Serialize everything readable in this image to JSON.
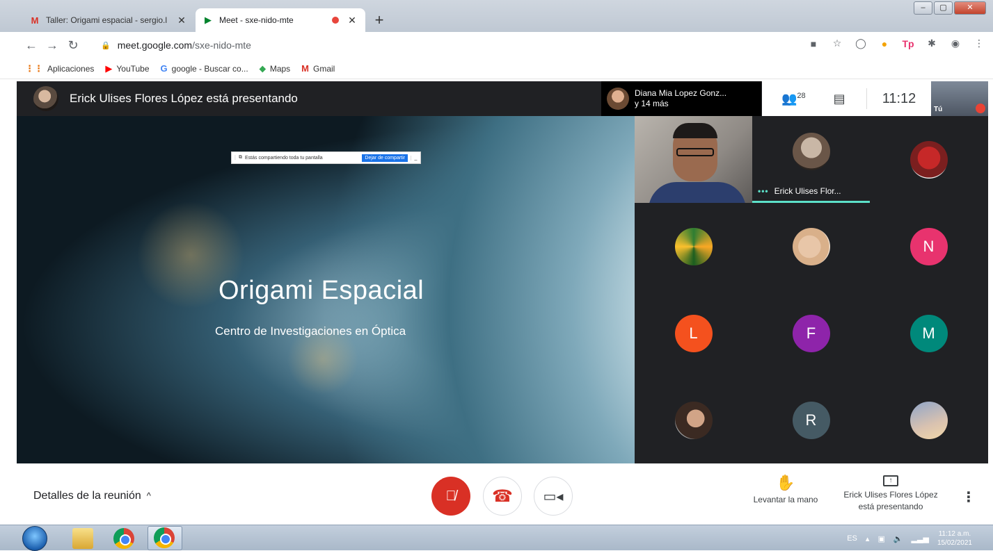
{
  "browser": {
    "tabs": [
      {
        "title": "Taller: Origami espacial - sergio.l",
        "favicon": "gmail-icon",
        "active": false
      },
      {
        "title": "Meet - sxe-nido-mte",
        "favicon": "meet-icon",
        "active": true
      }
    ],
    "new_tab": "+",
    "url_host": "meet.google.com",
    "url_path": "/sxe-nido-mte",
    "bookmarks": [
      {
        "label": "Aplicaciones",
        "icon": "apps-icon"
      },
      {
        "label": "YouTube",
        "icon": "youtube-icon"
      },
      {
        "label": "google - Buscar co...",
        "icon": "google-icon"
      },
      {
        "label": "Maps",
        "icon": "maps-icon"
      },
      {
        "label": "Gmail",
        "icon": "gmail-icon"
      }
    ]
  },
  "meet": {
    "presenter_banner": "Erick Ulises Flores López está presentando",
    "pinned_name": "Diana Mia Lopez Gonz...",
    "pinned_more": "y 14 más",
    "participant_count": "28",
    "time": "11:12",
    "self_label": "Tú",
    "share_bar": {
      "text": "Estás compartiendo toda tu pantalla",
      "stop_label": "Dejar de compartir",
      "minimize": "_"
    },
    "slide": {
      "title": "Origami Espacial",
      "subtitle": "Centro de Investigaciones en Óptica"
    },
    "tiles": [
      {
        "type": "video"
      },
      {
        "type": "photo",
        "speaking_label": "Erick Ulises Flor...",
        "dots": "•••"
      },
      {
        "type": "photo"
      },
      {
        "type": "photo"
      },
      {
        "type": "photo"
      },
      {
        "type": "letter",
        "letter": "N",
        "color": "#e8336e"
      },
      {
        "type": "letter",
        "letter": "L",
        "color": "#f4511e"
      },
      {
        "type": "letter",
        "letter": "F",
        "color": "#8e24aa"
      },
      {
        "type": "letter",
        "letter": "M",
        "color": "#00897b"
      },
      {
        "type": "photo"
      },
      {
        "type": "letter",
        "letter": "R",
        "color": "#455a64"
      },
      {
        "type": "photo"
      }
    ]
  },
  "controls": {
    "details": "Detalles de la reunión",
    "details_icon": "^",
    "raise_hand": "Levantar la mano",
    "presenting_line1": "Erick Ulises Flores López",
    "presenting_line2": "está presentando",
    "more": "⋮"
  },
  "taskbar": {
    "lang": "ES",
    "clock_time": "11:12 a.m.",
    "clock_date": "15/02/2021"
  }
}
